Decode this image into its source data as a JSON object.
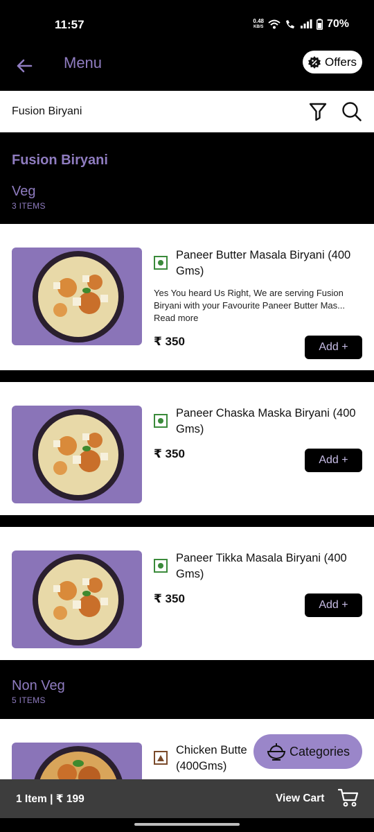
{
  "status_bar": {
    "time": "11:57",
    "net_speed_value": "0.48",
    "net_speed_unit": "KB/S",
    "battery": "70%",
    "icons": [
      "wifi-icon",
      "wifi-call-icon",
      "signal-icon",
      "battery-icon"
    ]
  },
  "app_bar": {
    "title": "Menu",
    "offers_label": "Offers",
    "icons": [
      "back-arrow-icon",
      "offer-badge-icon"
    ]
  },
  "search": {
    "label": "Fusion Biryani",
    "icons": [
      "filter-icon",
      "search-icon"
    ]
  },
  "sections": [
    {
      "title": "Fusion Biryani",
      "group": "Veg",
      "count": "3 ITEMS",
      "items": [
        {
          "type": "veg",
          "name": "Paneer Butter Masala Biryani (400 Gms)",
          "description": "Yes You heard Us Right, We are serving Fusion Biryani with your Favourite Paneer Butter Mas...",
          "read_more": "Read more",
          "price": "₹ 350",
          "add_label": "Add +"
        },
        {
          "type": "veg",
          "name": "Paneer Chaska Maska Biryani (400 Gms)",
          "price": "₹ 350",
          "add_label": "Add +"
        },
        {
          "type": "veg",
          "name": "Paneer Tikka Masala Biryani (400 Gms)",
          "price": "₹ 350",
          "add_label": "Add +"
        }
      ]
    },
    {
      "group": "Non Veg",
      "count": "5 ITEMS",
      "items": [
        {
          "type": "non-veg",
          "name": "Chicken Butte",
          "name_line2": "(400Gms)"
        }
      ]
    }
  ],
  "categories_button": {
    "label": "Categories",
    "icon": "food-bowl-icon"
  },
  "cart_bar": {
    "summary": "1 Item | ₹ 199",
    "view_cart_label": "View Cart",
    "icon": "cart-icon"
  },
  "colors": {
    "accent": "#8f7cc0",
    "image_bg": "#8a74b8",
    "veg": "#3a8a3a",
    "non_veg": "#7a4a2a",
    "cart_bar": "#3d3d3d"
  }
}
